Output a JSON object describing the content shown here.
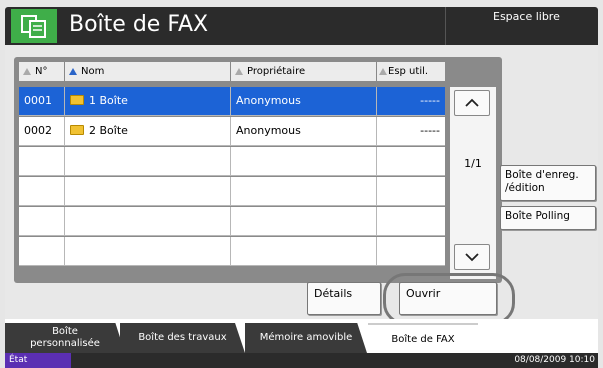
{
  "title_bar": {
    "title": "Boîte de FAX",
    "free_space_label": "Espace libre",
    "icon": "copy-box-icon",
    "icon_color": "#3fae49"
  },
  "table": {
    "columns": [
      {
        "label": "N°",
        "sort": "gray"
      },
      {
        "label": "Nom",
        "sort": "blue"
      },
      {
        "label": "Propriétaire",
        "sort": "gray"
      },
      {
        "label": "Esp util.",
        "sort": "gray"
      }
    ],
    "rows": [
      {
        "num": "0001",
        "name": "1  Boîte",
        "owner": "Anonymous",
        "space": "-----",
        "selected": true,
        "icon": "folder-icon"
      },
      {
        "num": "0002",
        "name": "2  Boîte",
        "owner": "Anonymous",
        "space": "-----",
        "selected": false,
        "icon": "folder-icon"
      },
      {
        "num": "",
        "name": "",
        "owner": "",
        "space": ""
      },
      {
        "num": "",
        "name": "",
        "owner": "",
        "space": ""
      },
      {
        "num": "",
        "name": "",
        "owner": "",
        "space": ""
      },
      {
        "num": "",
        "name": "",
        "owner": "",
        "space": ""
      }
    ],
    "selected_color": "#1c63d6"
  },
  "pager": {
    "indicator": "1/1",
    "up_icon": "chevron-up-icon",
    "down_icon": "chevron-down-icon"
  },
  "side_buttons": {
    "register_edit": "Boîte d'enreg.\n/édition",
    "polling": "Boîte Polling"
  },
  "bottom_buttons": {
    "details": "Détails",
    "open": "Ouvrir"
  },
  "tabs": [
    {
      "label": "Boîte\npersonnalisée",
      "active": false
    },
    {
      "label": "Boîte des travaux",
      "active": false
    },
    {
      "label": "Mémoire amovible",
      "active": false
    },
    {
      "label": "Boîte de FAX",
      "active": true
    }
  ],
  "status_bar": {
    "state": "État",
    "datetime": "08/08/2009   10:10",
    "state_color": "#5b2fb3"
  }
}
